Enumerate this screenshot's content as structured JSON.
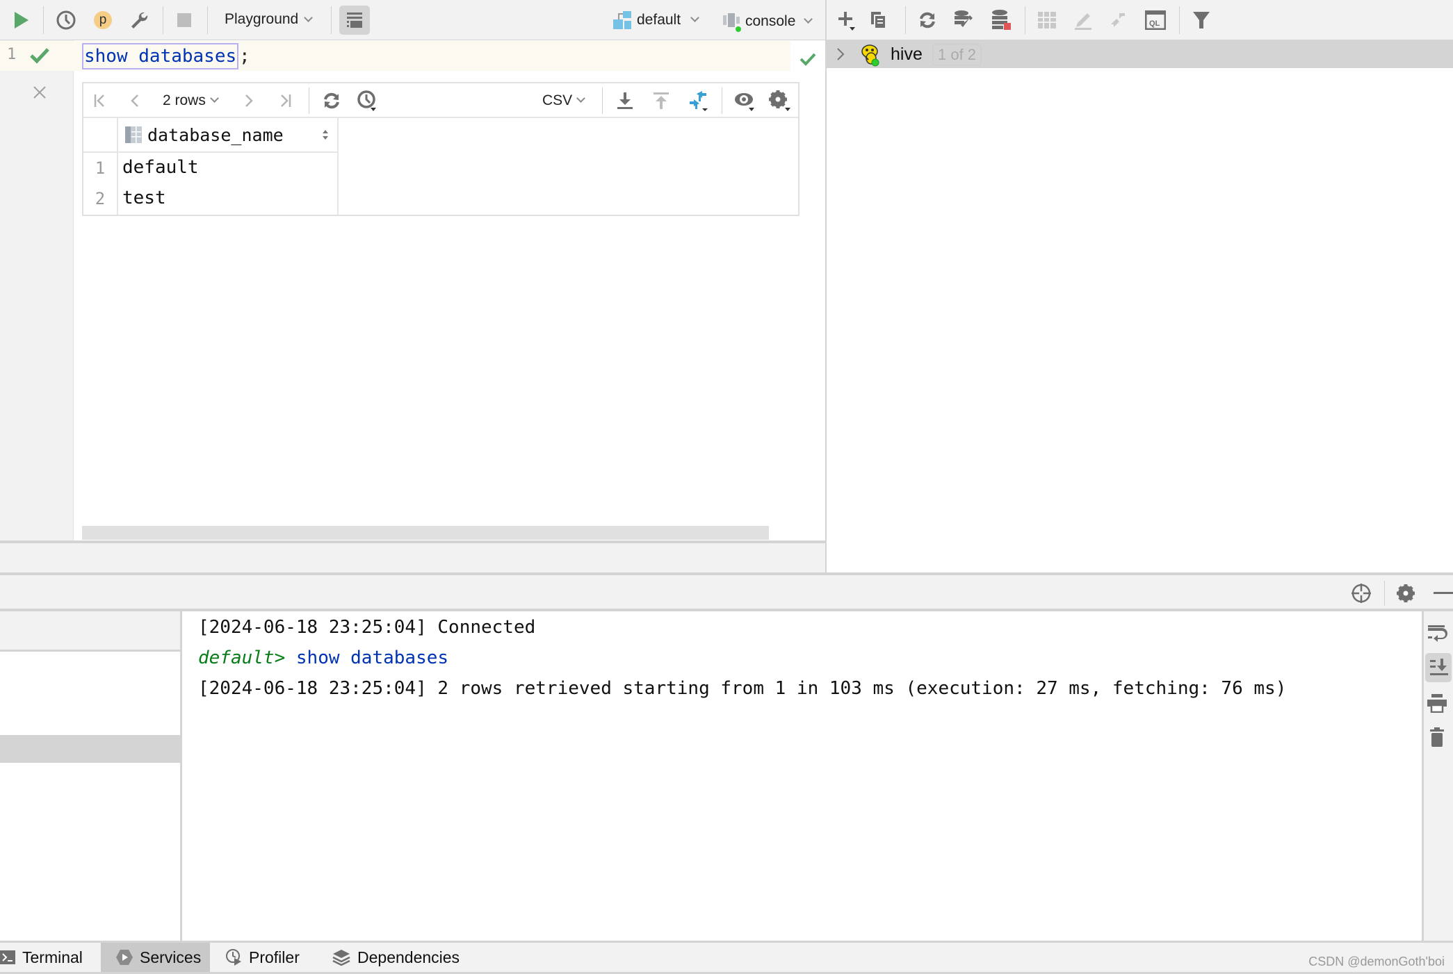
{
  "toolbar": {
    "run_icon": "play-icon",
    "history_icon": "clock-icon",
    "profile_badge": "p",
    "settings_icon": "wrench-icon",
    "stop_icon": "stop-icon",
    "mode_dropdown": "Playground",
    "schema_dropdown": "default",
    "session_dropdown": "console",
    "colors": {
      "run": "#59a869",
      "badge": "#f5cd87",
      "accent": "#389fd6"
    }
  },
  "db_toolbar": {
    "icons": [
      "add-icon",
      "copy-icon",
      "refresh-icon",
      "database-settings-icon",
      "database-stop-icon",
      "table-icon",
      "edit-icon",
      "jump-icon",
      "query-console-icon",
      "filter-icon"
    ]
  },
  "editor": {
    "line_number": "1",
    "sql_keyword": "show databases",
    "sql_terminator": ";"
  },
  "result": {
    "row_count": "2 rows",
    "export_format": "CSV",
    "columns": [
      "database_name"
    ],
    "rows": [
      {
        "num": "1",
        "database_name": "default"
      },
      {
        "num": "2",
        "database_name": "test"
      }
    ]
  },
  "tree": {
    "node_label": "hive",
    "node_badge": "1 of 2"
  },
  "console": {
    "lines": [
      {
        "timestamp": "[2024-06-18 23:25:04]",
        "text": " Connected"
      },
      {
        "prompt": "default>",
        "command": " show databases"
      },
      {
        "timestamp": "[2024-06-18 23:25:04]",
        "text": " 2 rows retrieved starting from 1 in 103 ms (execution: 27 ms, fetching: 76 ms)"
      }
    ]
  },
  "bottom_tabs": [
    {
      "label": "Terminal",
      "icon": "terminal-icon",
      "active": false
    },
    {
      "label": "Services",
      "icon": "services-icon",
      "active": true
    },
    {
      "label": "Profiler",
      "icon": "profiler-icon",
      "active": false
    },
    {
      "label": "Dependencies",
      "icon": "dependencies-icon",
      "active": false
    }
  ],
  "watermark": "CSDN @demonGoth'boi"
}
